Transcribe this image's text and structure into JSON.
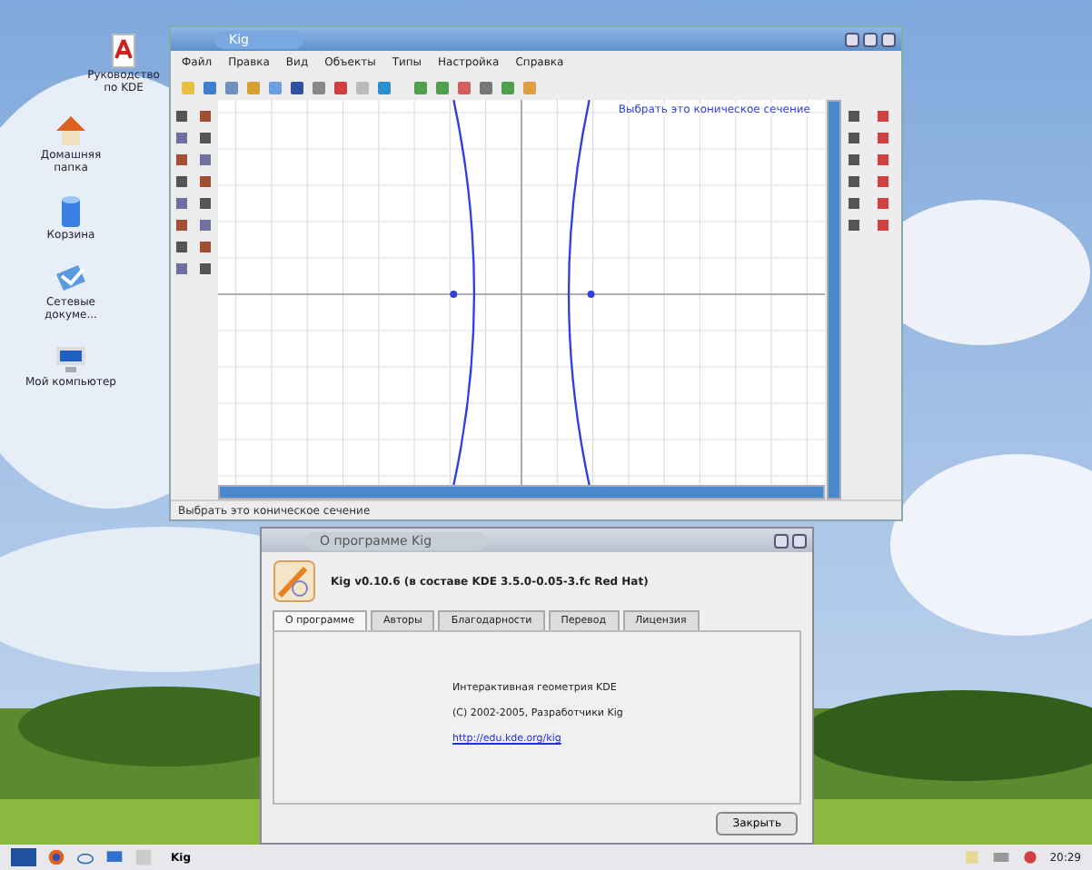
{
  "desktop_icons": [
    {
      "label": "Руководство по KDE"
    },
    {
      "label": "Домашняя папка"
    },
    {
      "label": "Корзина"
    },
    {
      "label": "Сетевые докуме..."
    },
    {
      "label": "Мой компьютер"
    }
  ],
  "kig_window": {
    "title": "Kig",
    "menu": [
      "Файл",
      "Правка",
      "Вид",
      "Объекты",
      "Типы",
      "Настройка",
      "Справка"
    ],
    "canvas_hint": "Выбрать это коническое сечение",
    "status_bar": "Выбрать это коническое сечение"
  },
  "about_dialog": {
    "title": "О программе Kig",
    "heading": "Kig v0.10.6 (в составе KDE 3.5.0-0.05-3.fc Red Hat)",
    "tabs": [
      {
        "label": "О программе",
        "selected": true
      },
      {
        "label": "Авторы",
        "selected": false
      },
      {
        "label": "Благодарности",
        "selected": false
      },
      {
        "label": "Перевод",
        "selected": false
      },
      {
        "label": "Лицензия",
        "selected": false
      }
    ],
    "lines": [
      "Интерактивная геометрия KDE",
      "(C) 2002-2005, Разработчики Kig"
    ],
    "link": "http://edu.kde.org/kig",
    "button": "Закрыть"
  },
  "taskbar": {
    "tasks": [
      {
        "label": "Kig",
        "selected": false
      }
    ],
    "clock": "20:29"
  }
}
